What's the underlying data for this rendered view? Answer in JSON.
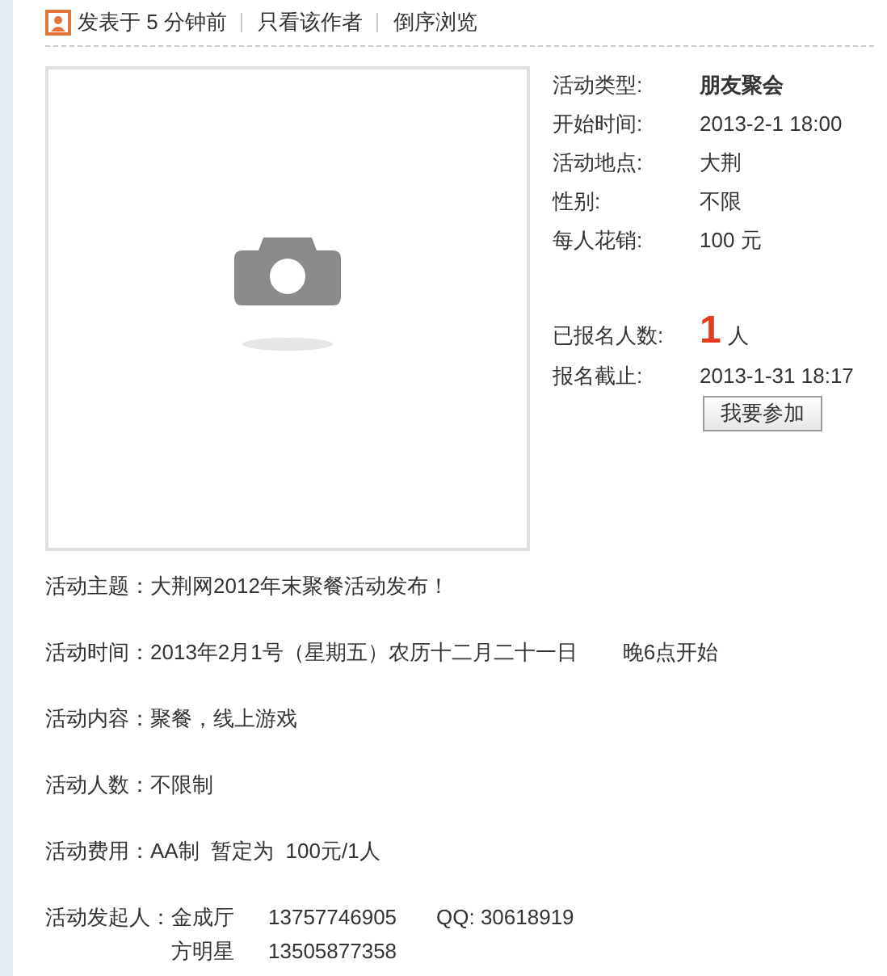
{
  "post_bar": {
    "posted": "发表于 5 分钟前",
    "links": [
      "只看该作者",
      "倒序浏览"
    ]
  },
  "details": [
    {
      "label": "活动类型:",
      "value": "朋友聚会",
      "bold": true
    },
    {
      "label": "开始时间:",
      "value": "2013-2-1 18:00",
      "bold": false
    },
    {
      "label": "活动地点:",
      "value": "大荆",
      "bold": false
    },
    {
      "label": "性别:",
      "value": "不限",
      "bold": false
    },
    {
      "label": "每人花销:",
      "value": "100 元",
      "bold": false
    }
  ],
  "signup": {
    "label": "已报名人数:",
    "count": "1",
    "unit": "人"
  },
  "deadline": {
    "label": "报名截止:",
    "value": "2013-1-31 18:17"
  },
  "join_button": "我要参加",
  "paragraphs": [
    {
      "label": "活动主题：",
      "parts": [
        "大荆网2012年末聚餐活动发布！"
      ]
    },
    {
      "label": "活动时间：",
      "parts": [
        "2013年2月1号（星期五）农历十二月二十一日",
        "晚6点开始"
      ]
    },
    {
      "label": "活动内容：",
      "parts": [
        "聚餐，线上游戏"
      ]
    },
    {
      "label": "活动人数：",
      "parts": [
        "不限制"
      ]
    },
    {
      "label": "活动费用：",
      "parts": [
        "AA制  暂定为  100元/1人"
      ]
    }
  ],
  "organizers": {
    "label": "活动发起人：",
    "people": [
      {
        "name": "金成厅",
        "phone": "13757746905",
        "qq": "QQ: 30618919"
      },
      {
        "name": "方明星",
        "phone": "13505877358"
      }
    ]
  }
}
